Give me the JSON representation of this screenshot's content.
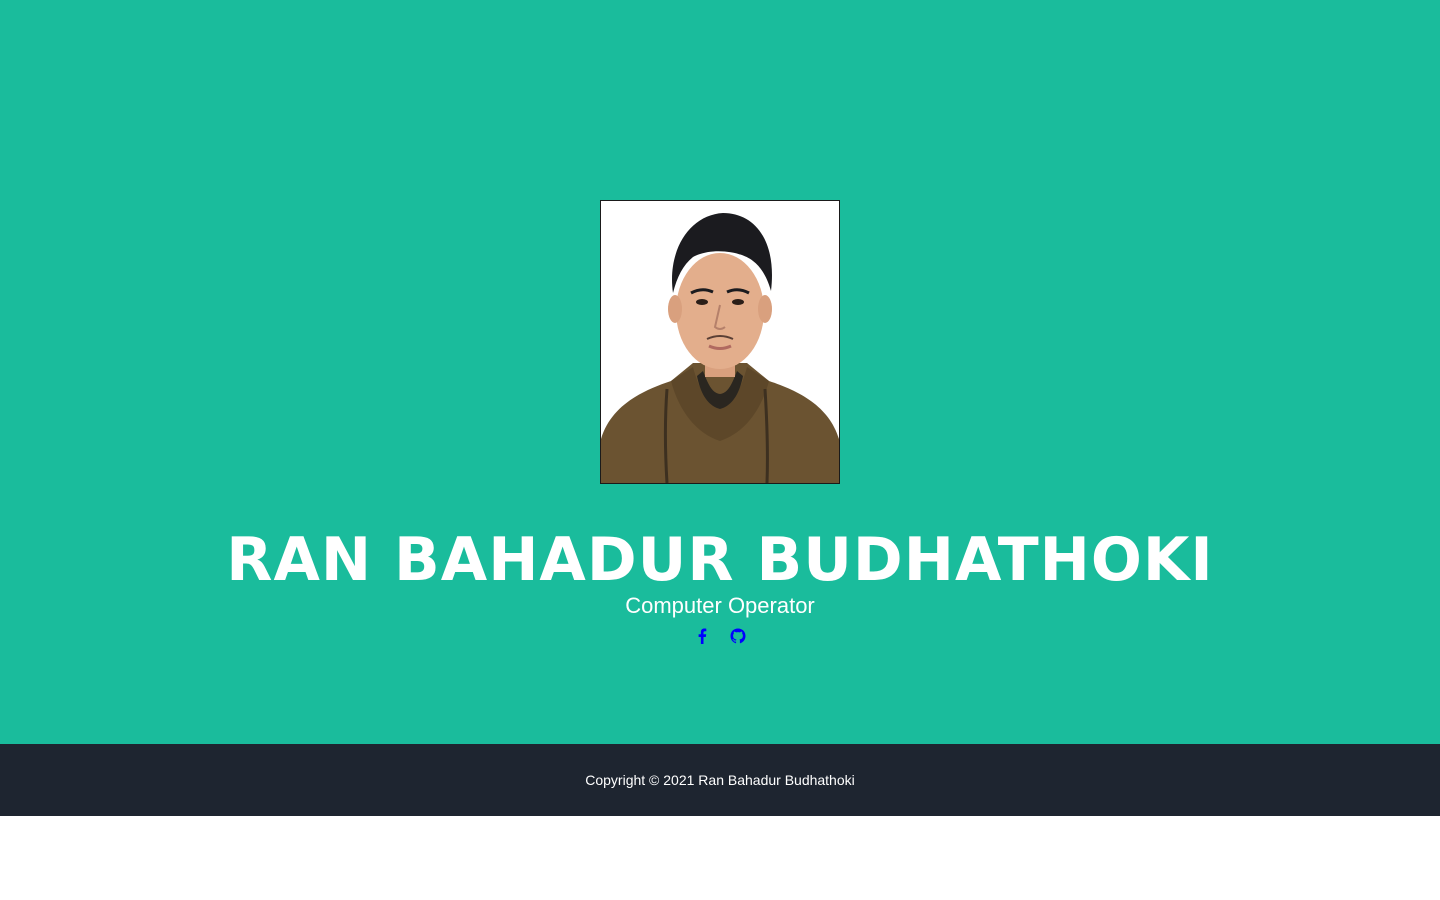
{
  "profile": {
    "name": "RAN BAHADUR BUDHATHOKI",
    "role": "Computer Operator",
    "photo_alt": "profile-photo"
  },
  "socials": [
    {
      "icon": "facebook-icon",
      "color": "#0000ff"
    },
    {
      "icon": "github-icon",
      "color": "#0000ff"
    }
  ],
  "footer": {
    "copyright": "Copyright © 2021 Ran Bahadur Budhathoki"
  },
  "colors": {
    "masthead_bg": "#1abc9c",
    "footer_bg": "#1e2530",
    "text": "#ffffff",
    "icon": "#0000ff"
  }
}
